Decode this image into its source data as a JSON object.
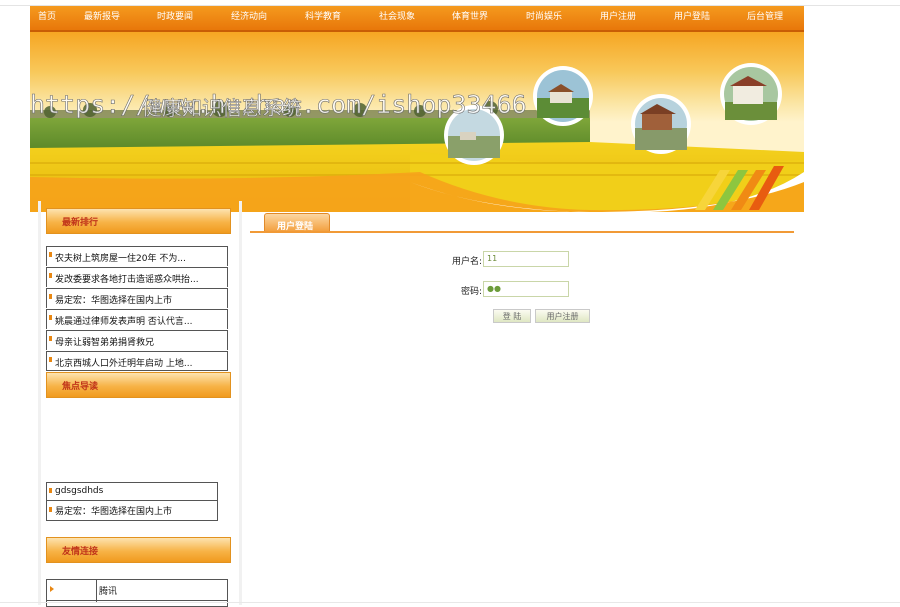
{
  "nav": {
    "items": [
      "首页",
      "最新报导",
      "时政要闻",
      "经济动向",
      "科学教育",
      "社会现象",
      "体育世界",
      "时尚娱乐",
      "用户注册",
      "用户登陆",
      "后台管理"
    ]
  },
  "banner": {
    "watermark": "https://www.huzhan.com/ishop33466",
    "overlay_text": "健康知识信息系统"
  },
  "sidebar": {
    "latest": {
      "title": "最新排行",
      "items": [
        "农夫树上筑房屋一住20年 不为...",
        "发改委要求各地打击造谣惑众哄抬...",
        "易定宏：华图选择在国内上市",
        "姚晨通过律师发表声明 否认代言...",
        "母亲让弱智弟弟捐肾救兄",
        "北京西城人口外迁明年启动 上地..."
      ]
    },
    "focus": {
      "title": "焦点导读",
      "items": [
        "gdsgsdhds",
        "易定宏：华图选择在国内上市"
      ]
    },
    "links": {
      "title": "友情连接",
      "items": [
        "腾讯"
      ]
    }
  },
  "main": {
    "tab_label": "用户登陆",
    "username_label": "用户名:",
    "username_value": "11",
    "password_label": "密码:",
    "password_value": "●●",
    "login_button": "登 陆",
    "register_button": "用户注册"
  },
  "colors": {
    "accent": "#f08a14",
    "title_red": "#c0341a"
  }
}
